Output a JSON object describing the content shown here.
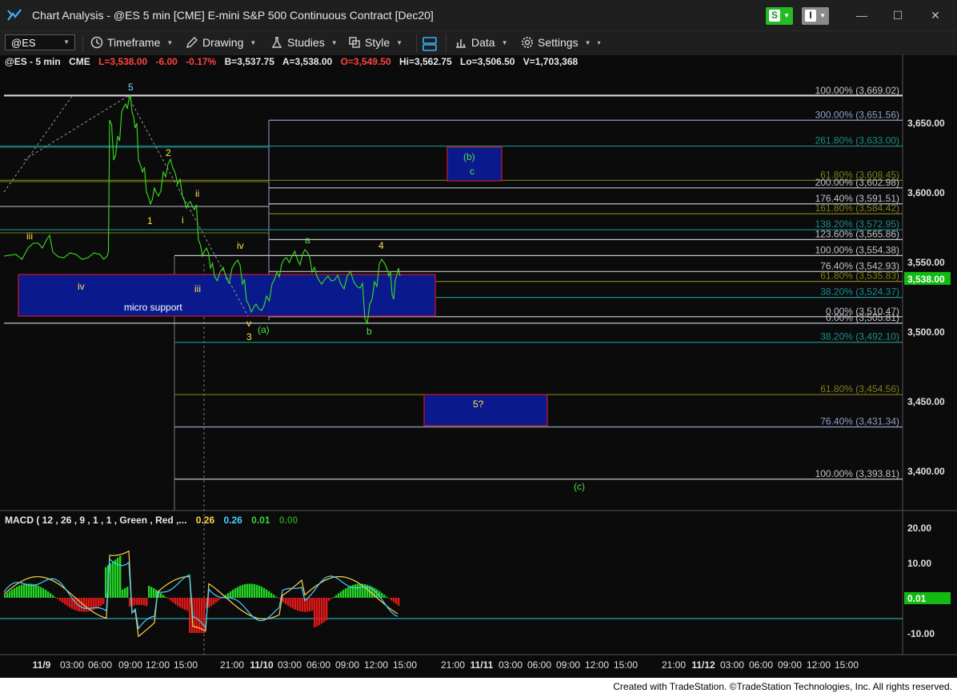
{
  "window": {
    "title": "Chart Analysis - @ES 5 min [CME] E-mini S&P 500 Continuous Contract [Dec20]",
    "btn_s": "S",
    "btn_i": "I"
  },
  "toolbar": {
    "symbol": "@ES",
    "timeframe": "Timeframe",
    "drawing": "Drawing",
    "studies": "Studies",
    "style": "Style",
    "data": "Data",
    "settings": "Settings"
  },
  "quote": {
    "symbol": "@ES - 5 min",
    "exchange": "CME",
    "last": "L=3,538.00",
    "change": "-6.00",
    "pct": "-0.17%",
    "bid": "B=3,537.75",
    "ask": "A=3,538.00",
    "open": "O=3,549.50",
    "high": "Hi=3,562.75",
    "low": "Lo=3,506.50",
    "volume": "V=1,703,368"
  },
  "macd": {
    "title": "MACD ( 12 , 26 , 9 , 1 , 1 , Green , Red ,...",
    "v1": "0.26",
    "v2": "0.26",
    "v3": "0.01",
    "v4": "0.00",
    "colors": {
      "v1": "#ffd34a",
      "v2": "#4ad2ff",
      "v3": "#39d339",
      "v4": "#1f8f1f"
    }
  },
  "footer": "Created with TradeStation. ©TradeStation Technologies, Inc. All rights reserved.",
  "colors": {
    "background": "#0b0b0b",
    "price_line": "#39e01c",
    "last_price_tag": "#11bb11",
    "zone_fill": "#0a1a8c",
    "zone_border": "#d0182a",
    "fib_gray": "#bfc3c9",
    "fib_teal": "#1c8c8c",
    "fib_olive": "#7d7d1e",
    "fib_slate": "#8ea0c8"
  },
  "chart_data": {
    "type": "line",
    "title": "@ES 5 min",
    "price_axis": {
      "ticks": [
        "3,650.00",
        "3,600.00",
        "3,550.00",
        "3,500.00",
        "3,450.00",
        "3,400.00"
      ],
      "values": [
        3650,
        3600,
        3550,
        3500,
        3450,
        3400
      ],
      "range": [
        3366,
        3724
      ]
    },
    "last_price": {
      "label": "3,538.00",
      "value": 3538
    },
    "time_axis": [
      "11/9",
      "03:00",
      "06:00",
      "09:00",
      "12:00",
      "15:00",
      "21:00",
      "11/10",
      "03:00",
      "06:00",
      "09:00",
      "12:00",
      "15:00",
      "21:00",
      "11/11",
      "03:00",
      "06:00",
      "09:00",
      "12:00",
      "15:00",
      "21:00",
      "11/12",
      "03:00",
      "06:00",
      "09:00",
      "12:00",
      "15:00"
    ],
    "fib_levels": [
      {
        "label": "100.00% (3,669.02)",
        "value": 3669.02,
        "color": "gray"
      },
      {
        "label": "300.00% (3,651.56)",
        "value": 3651.56,
        "color": "slate"
      },
      {
        "label": "261.80% (3,633.00)",
        "value": 3633.0,
        "color": "teal"
      },
      {
        "label": "61.80% (3,608.45)",
        "value": 3608.45,
        "color": "olive"
      },
      {
        "label": "200.00% (3,602.98)",
        "value": 3602.98,
        "color": "gray"
      },
      {
        "label": "176.40% (3,591.51)",
        "value": 3591.51,
        "color": "gray"
      },
      {
        "label": "161.80% (3,584.42)",
        "value": 3584.42,
        "color": "olive"
      },
      {
        "label": "138.20% (3,572.95)",
        "value": 3572.95,
        "color": "teal"
      },
      {
        "label": "123.60% (3,565.86)",
        "value": 3565.86,
        "color": "gray"
      },
      {
        "label": "100.00% (3,554.38)",
        "value": 3554.38,
        "color": "gray"
      },
      {
        "label": "76.40% (3,542.93)",
        "value": 3542.93,
        "color": "gray"
      },
      {
        "label": "61.80% (3,535.83)",
        "value": 3535.83,
        "color": "olive"
      },
      {
        "label": "38.20% (3,524.37)",
        "value": 3524.37,
        "color": "teal"
      },
      {
        "label": "0.00% (3,510.47)",
        "value": 3510.47,
        "color": "gray"
      },
      {
        "label": "0.00% (3,505.81)",
        "value": 3505.81,
        "color": "gray"
      },
      {
        "label": "38.20% (3,492.10)",
        "value": 3492.1,
        "color": "teal"
      },
      {
        "label": "61.80% (3,454.56)",
        "value": 3454.56,
        "color": "olive"
      },
      {
        "label": "76.40% (3,431.34)",
        "value": 3431.34,
        "color": "slate"
      },
      {
        "label": "100.00% (3,393.81)",
        "value": 3393.81,
        "color": "gray"
      }
    ],
    "wave_labels": [
      "5",
      "2",
      "ii",
      "1",
      "i",
      "iii",
      "iv",
      "iii",
      "iv",
      "v",
      "3",
      "(a)",
      "a",
      "b",
      "4",
      "(b)",
      "c",
      "5?",
      "(c)"
    ],
    "zone_labels": [
      "micro support",
      "(b)",
      "c",
      "5?"
    ],
    "macd_axis": {
      "ticks": [
        "20.00",
        "10.00",
        "-10.00"
      ],
      "values": [
        20,
        10,
        -10
      ],
      "range": [
        -15,
        22
      ]
    },
    "macd_last": "0.01"
  }
}
